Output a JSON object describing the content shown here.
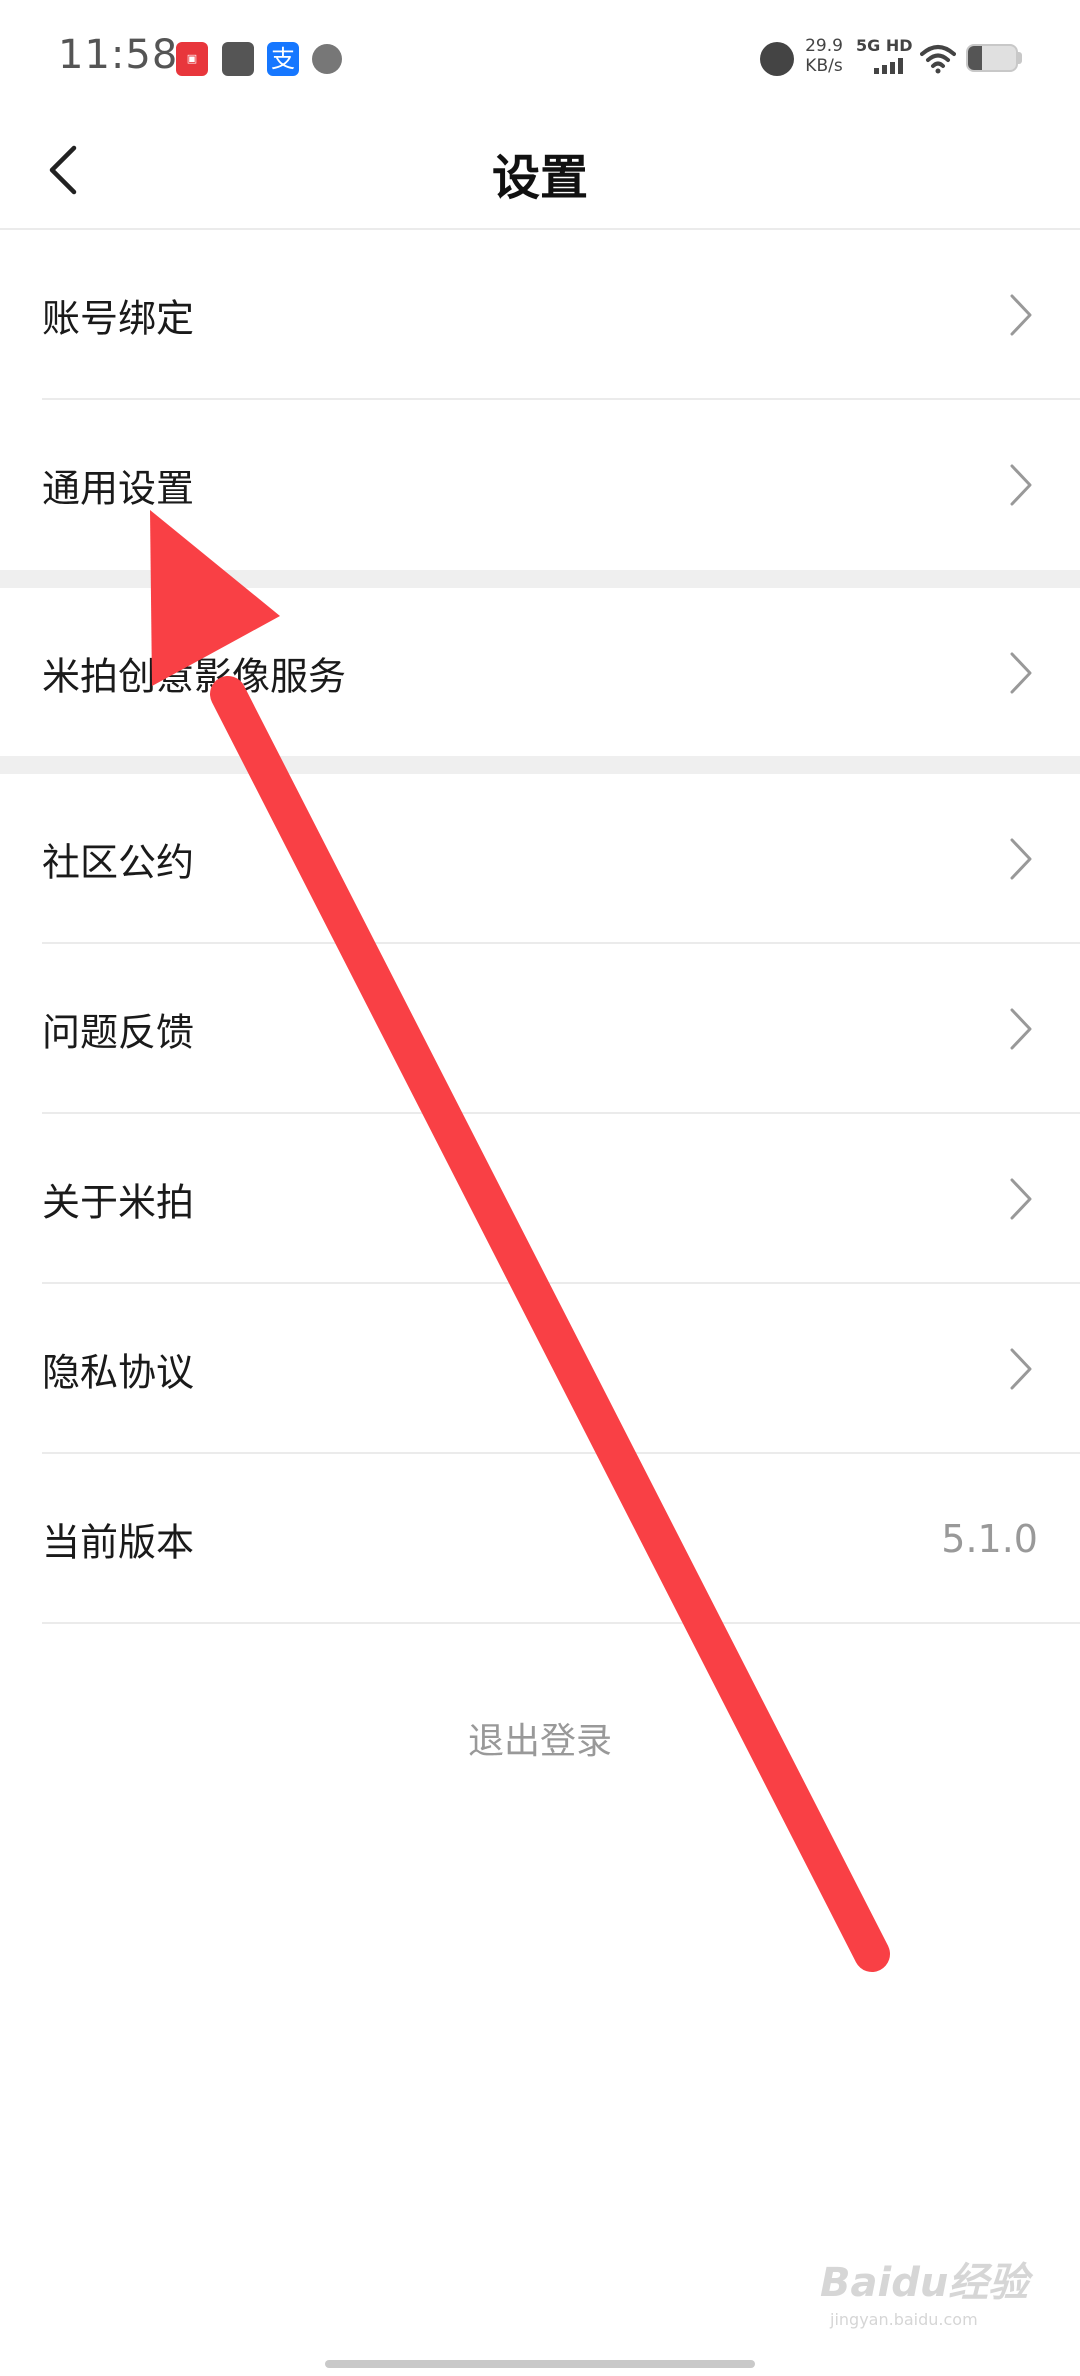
{
  "status_bar": {
    "time": "11:58",
    "net_speed_value": "29.9",
    "net_speed_unit": "KB/s",
    "network_type": "5G HD",
    "battery_percent": 30,
    "notification_icons": [
      "jd-icon",
      "app-icon",
      "alipay-icon",
      "browser-icon"
    ]
  },
  "header": {
    "title": "设置"
  },
  "settings": {
    "items": [
      {
        "label": "账号绑定"
      },
      {
        "label": "通用设置"
      },
      {
        "label": "米拍创意影像服务"
      },
      {
        "label": "社区公约"
      },
      {
        "label": "问题反馈"
      },
      {
        "label": "关于米拍"
      },
      {
        "label": "隐私协议"
      },
      {
        "label": "当前版本",
        "value": "5.1.0"
      }
    ],
    "logout_label": "退出登录"
  },
  "overlay": {
    "arrow_color": "#f94045"
  },
  "watermark": {
    "text": "Baidu经验",
    "sub": "jingyan.baidu.com"
  }
}
